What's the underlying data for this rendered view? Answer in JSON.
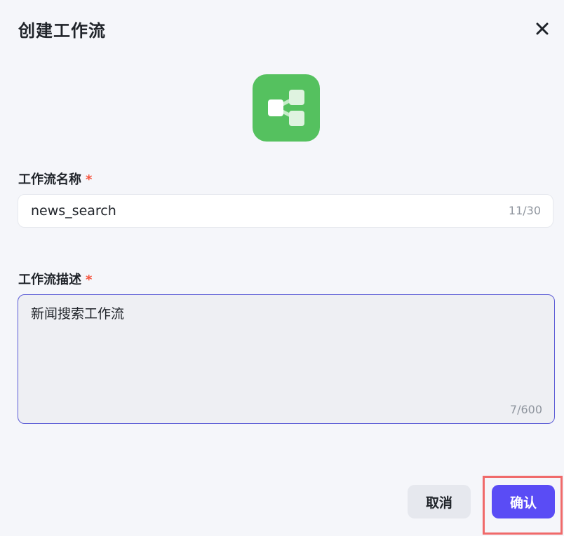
{
  "dialog": {
    "title": "创建工作流",
    "close_icon": "close-icon",
    "workflow_icon": "workflow-share-icon",
    "accent_color": "#5a4cf5",
    "icon_bg_color": "#55c15f"
  },
  "name_field": {
    "label": "工作流名称",
    "required_mark": "*",
    "value": "news_search",
    "counter": "11/30"
  },
  "desc_field": {
    "label": "工作流描述",
    "required_mark": "*",
    "value": "新闻搜索工作流",
    "counter": "7/600"
  },
  "footer": {
    "cancel_label": "取消",
    "confirm_label": "确认"
  }
}
